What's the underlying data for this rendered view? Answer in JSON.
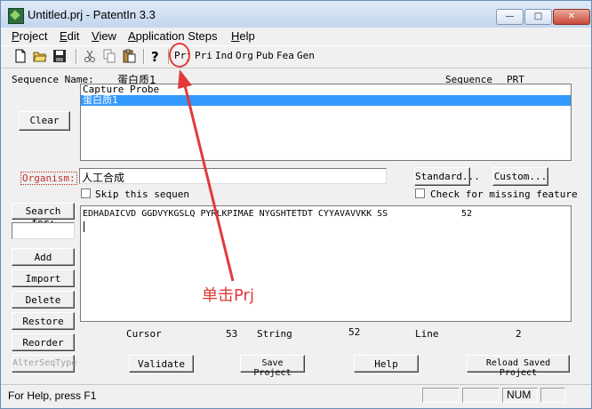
{
  "window": {
    "title": "Untitled.prj - PatentIn 3.3",
    "controls": {
      "minimize": "—",
      "maximize": "□",
      "close": "✕"
    }
  },
  "menu": [
    {
      "label": "Project",
      "underline": "P",
      "rest": "roject"
    },
    {
      "label": "Edit",
      "underline": "E",
      "rest": "dit"
    },
    {
      "label": "View",
      "underline": "V",
      "rest": "iew"
    },
    {
      "label": "Application Steps",
      "underline": "A",
      "rest": "pplication Steps"
    },
    {
      "label": "Help",
      "underline": "H",
      "rest": "elp"
    }
  ],
  "toolbar": {
    "icons": [
      "new-file-icon",
      "open-folder-icon",
      "save-icon",
      "cut-icon",
      "copy-icon",
      "paste-icon",
      "help-question-icon"
    ],
    "text_buttons": [
      "Prj",
      "Pri",
      "Ind",
      "Org",
      "Pub",
      "Fea",
      "Gen"
    ]
  },
  "sequence": {
    "name_label": "Sequence Name:",
    "name_value": "蛋白质1",
    "type_label": "Sequence",
    "type_value": "PRT",
    "list": [
      {
        "text": "Capture Probe",
        "selected": false
      },
      {
        "text": "蛋白质1",
        "selected": true
      }
    ],
    "clear_button": "Clear"
  },
  "organism": {
    "label": "Organism:",
    "value": "人工合成",
    "standard_button": "Standard...",
    "custom_button": "Custom...",
    "skip_label": "Skip this sequen",
    "check_label": "Check for missing feature"
  },
  "search": {
    "label": "Search for:",
    "value": ""
  },
  "side_buttons": [
    "Add",
    "Import",
    "Delete",
    "Restore",
    "Reorder",
    "AlterSeqType"
  ],
  "editor": {
    "sequence_text": "EDHADAICVD GGDVYKGSLQ PYRLKPIMAE NYGSHTETDT CYYAVAVVKK SS",
    "length": "52"
  },
  "stats": {
    "cursor_label": "Cursor",
    "cursor_value": "53",
    "string_label": "String",
    "string_value": "52",
    "line_label": "Line",
    "line_value": "2"
  },
  "bottom_buttons": {
    "validate": "Validate",
    "save_project": "Save Project",
    "help": "Help",
    "reload": "Reload Saved Project"
  },
  "status": {
    "text": "For Help, press F1",
    "num": "NUM"
  },
  "annotation": {
    "text": "单击Prj",
    "color": "#e23a3a"
  }
}
